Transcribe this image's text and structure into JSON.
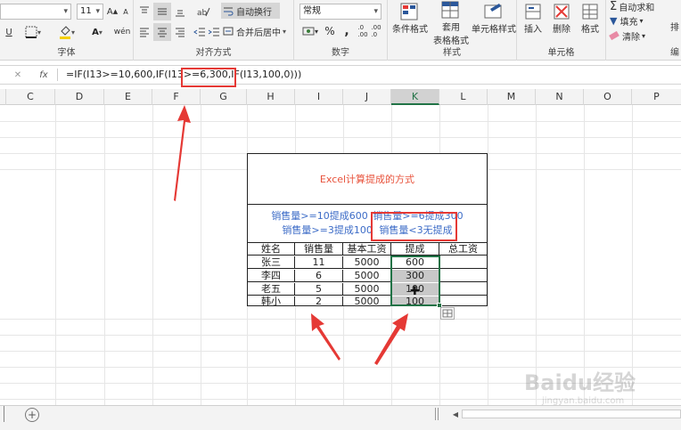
{
  "ribbon": {
    "font_size": "11",
    "font_group_label": "字体",
    "align_group_label": "对齐方式",
    "wrap_text_label": "自动换行",
    "merge_center_label": "合并后居中",
    "number_format": "常规",
    "number_group_label": "数字",
    "conditional_format_label": "条件格式",
    "table_format_label_1": "套用",
    "table_format_label_2": "表格格式",
    "cell_style_label": "单元格样式",
    "style_group_label": "样式",
    "insert_label": "插入",
    "delete_label": "删除",
    "format_label": "格式",
    "cells_group_label": "单元格",
    "autosum_label": "自动求和",
    "fill_label": "填充",
    "clear_label": "清除",
    "sort_label": "排",
    "edit_group_label": "编",
    "percent": "%",
    "comma": ",",
    "font_a": "A",
    "underline": "U"
  },
  "formula_bar": {
    "fx": "fx",
    "formula": "=IF(I13>=10,600,IF(I13>=6,300,IF(I13,100,0)))"
  },
  "columns": [
    "C",
    "D",
    "E",
    "F",
    "G",
    "H",
    "I",
    "J",
    "K",
    "L",
    "M",
    "N",
    "O",
    "P"
  ],
  "table": {
    "title": "Excel计算提成的方式",
    "rule_line1_a": "销售量>=10提成600",
    "rule_line1_b": "销售量>=6提成300",
    "rule_line2_a": "销售量>=3提成100",
    "rule_line2_b": "销售量<3无提成",
    "headers": [
      "姓名",
      "销售量",
      "基本工资",
      "提成",
      "总工资"
    ],
    "rows": [
      [
        "张三",
        "11",
        "5000",
        "600",
        ""
      ],
      [
        "李四",
        "6",
        "5000",
        "300",
        ""
      ],
      [
        "老五",
        "5",
        "5000",
        "100",
        ""
      ],
      [
        "韩小",
        "2",
        "5000",
        "100",
        ""
      ]
    ]
  },
  "watermark": {
    "brand": "Baidu经验",
    "url": "jingyan.baidu.com"
  },
  "colors": {
    "title_red": "#e8533c",
    "rule_blue": "#3d6cc7",
    "annotation_red": "#e53935",
    "selection_green": "#217346"
  }
}
